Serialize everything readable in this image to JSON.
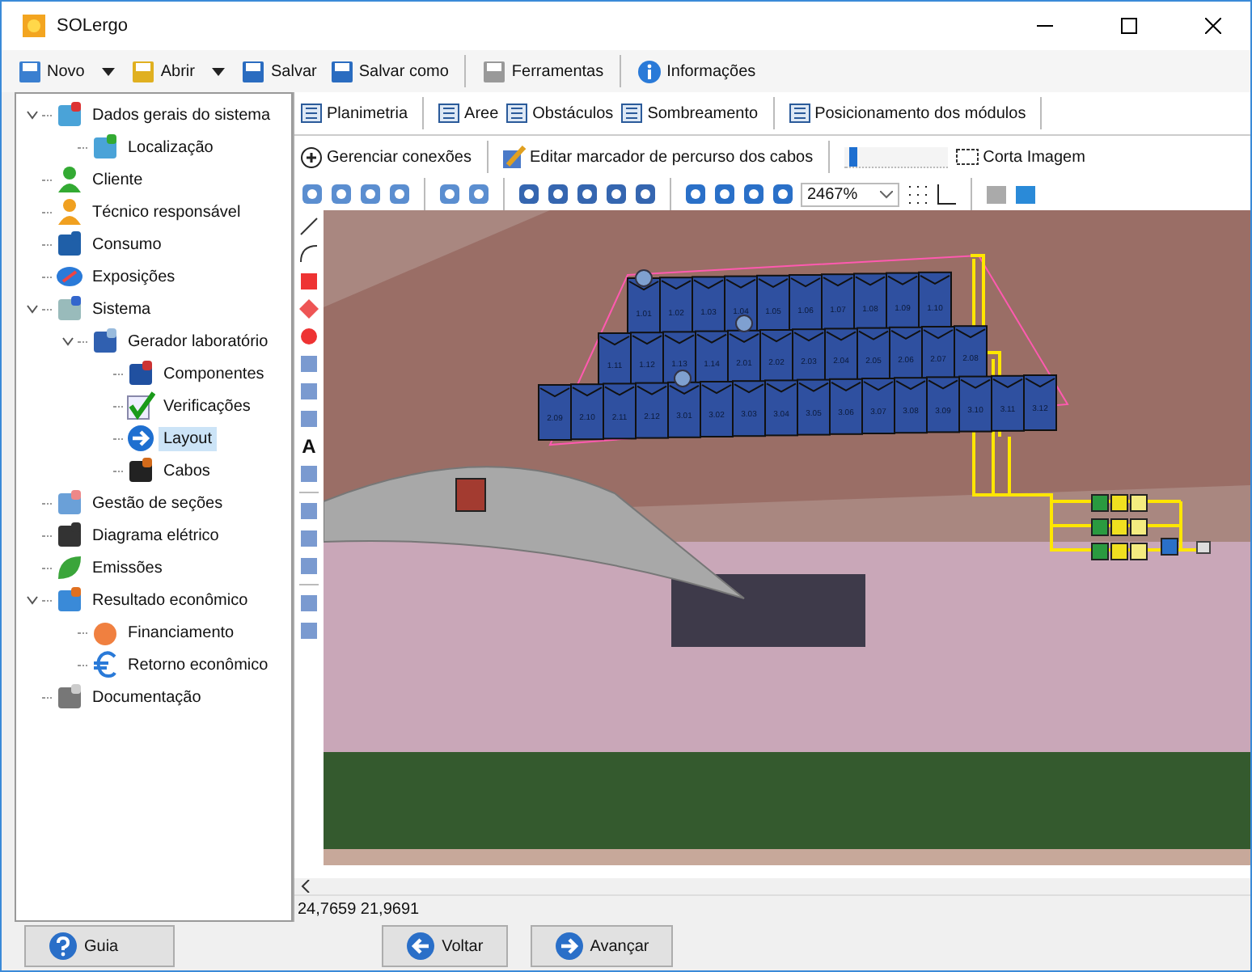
{
  "window": {
    "title": "SOLergo"
  },
  "toolbar": [
    {
      "label": "Novo",
      "dropdown": true
    },
    {
      "label": "Abrir",
      "dropdown": true
    },
    {
      "label": "Salvar",
      "dropdown": false
    },
    {
      "label": "Salvar como",
      "dropdown": false
    },
    {
      "label": "Ferramentas",
      "dropdown": false
    },
    {
      "label": "Informações",
      "dropdown": false
    }
  ],
  "tree": [
    {
      "label": "Dados gerais do sistema",
      "selected": false,
      "expanded": true,
      "children": [
        {
          "label": "Localização",
          "selected": false
        }
      ]
    },
    {
      "label": "Cliente",
      "selected": false
    },
    {
      "label": "Técnico responsável",
      "selected": false
    },
    {
      "label": "Consumo",
      "selected": false
    },
    {
      "label": "Exposições",
      "selected": false
    },
    {
      "label": "Sistema",
      "selected": false,
      "expanded": true,
      "children": [
        {
          "label": "Gerador laboratório",
          "selected": false,
          "expanded": true,
          "children": [
            {
              "label": "Componentes",
              "selected": false
            },
            {
              "label": "Verificações",
              "selected": false
            },
            {
              "label": "Layout",
              "selected": true
            },
            {
              "label": "Cabos",
              "selected": false
            }
          ]
        }
      ]
    },
    {
      "label": "Gestão de seções",
      "selected": false
    },
    {
      "label": "Diagrama elétrico",
      "selected": false
    },
    {
      "label": "Emissões",
      "selected": false
    },
    {
      "label": "Resultado econômico",
      "selected": false,
      "expanded": true,
      "children": [
        {
          "label": "Financiamento",
          "selected": false
        },
        {
          "label": "Retorno econômico",
          "selected": false
        }
      ]
    },
    {
      "label": "Documentação",
      "selected": false
    }
  ],
  "tabs": [
    "Planimetria",
    "Aree",
    "Obstáculos",
    "Sombreamento",
    "Posicionamento dos módulos"
  ],
  "actions": {
    "manage_connections": "Gerenciar conexões",
    "edit_cable_marker": "Editar marcador de percurso dos cabos",
    "slider": {
      "level": 0.08
    },
    "crop_image": "Corta Imagem"
  },
  "zoom_select": {
    "value": "2467%"
  },
  "text_tool": "A",
  "modules": [
    [
      "1.01",
      "1.02",
      "1.03",
      "1.04",
      "1.05",
      "1.06",
      "1.07",
      "1.08",
      "1.09",
      "1.10"
    ],
    [
      "1.11",
      "1.12",
      "1.13",
      "1.14",
      "2.01",
      "2.02",
      "2.03",
      "2.04",
      "2.05",
      "2.06",
      "2.07",
      "2.08"
    ],
    [
      "2.09",
      "2.10",
      "2.11",
      "2.12",
      "3.01",
      "3.02",
      "3.03",
      "3.04",
      "3.05",
      "3.06",
      "3.07",
      "3.08",
      "3.09",
      "3.10",
      "3.11",
      "3.12"
    ]
  ],
  "status_bar": {
    "coordinates": "24,7659 21,9691"
  },
  "buttons": {
    "help": "Guia",
    "back": "Voltar",
    "next": "Avançar"
  }
}
